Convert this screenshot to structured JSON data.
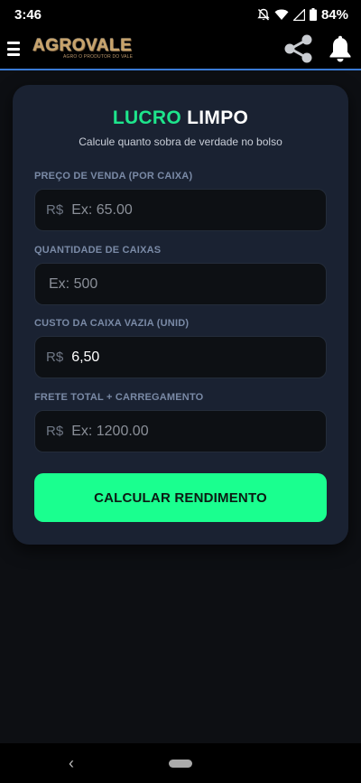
{
  "status": {
    "time": "3:46",
    "battery": "84%",
    "icons": [
      "notifications-off-icon",
      "wifi-icon",
      "signal-icon",
      "battery-icon"
    ]
  },
  "app": {
    "logo_text": "AGROVALE",
    "logo_sub": "AGRO O PRODUTOR DO VALE",
    "menu_icon": "menu-icon",
    "share_icon": "share-icon",
    "bell_icon": "bell-icon"
  },
  "card": {
    "title_accent": "LUCRO",
    "title_main": "LIMPO",
    "subtitle": "Calcule quanto sobra de verdade no bolso",
    "fields": [
      {
        "label": "PREÇO DE VENDA (POR CAIXA)",
        "prefix": "R$",
        "placeholder": "Ex: 65.00",
        "value": ""
      },
      {
        "label": "QUANTIDADE DE CAIXAS",
        "prefix": "",
        "placeholder": "Ex: 500",
        "value": ""
      },
      {
        "label": "CUSTO DA CAIXA VAZIA (UNID)",
        "prefix": "R$",
        "placeholder": "",
        "value": "6,50"
      },
      {
        "label": "FRETE TOTAL + CARREGAMENTO",
        "prefix": "R$",
        "placeholder": "Ex: 1200.00",
        "value": ""
      }
    ],
    "button_label": "CALCULAR RENDIMENTO"
  },
  "colors": {
    "accent": "#1ee58c",
    "button": "#1aff8f",
    "card_bg": "#1a2232",
    "app_bar_border": "#3a7bd5"
  }
}
